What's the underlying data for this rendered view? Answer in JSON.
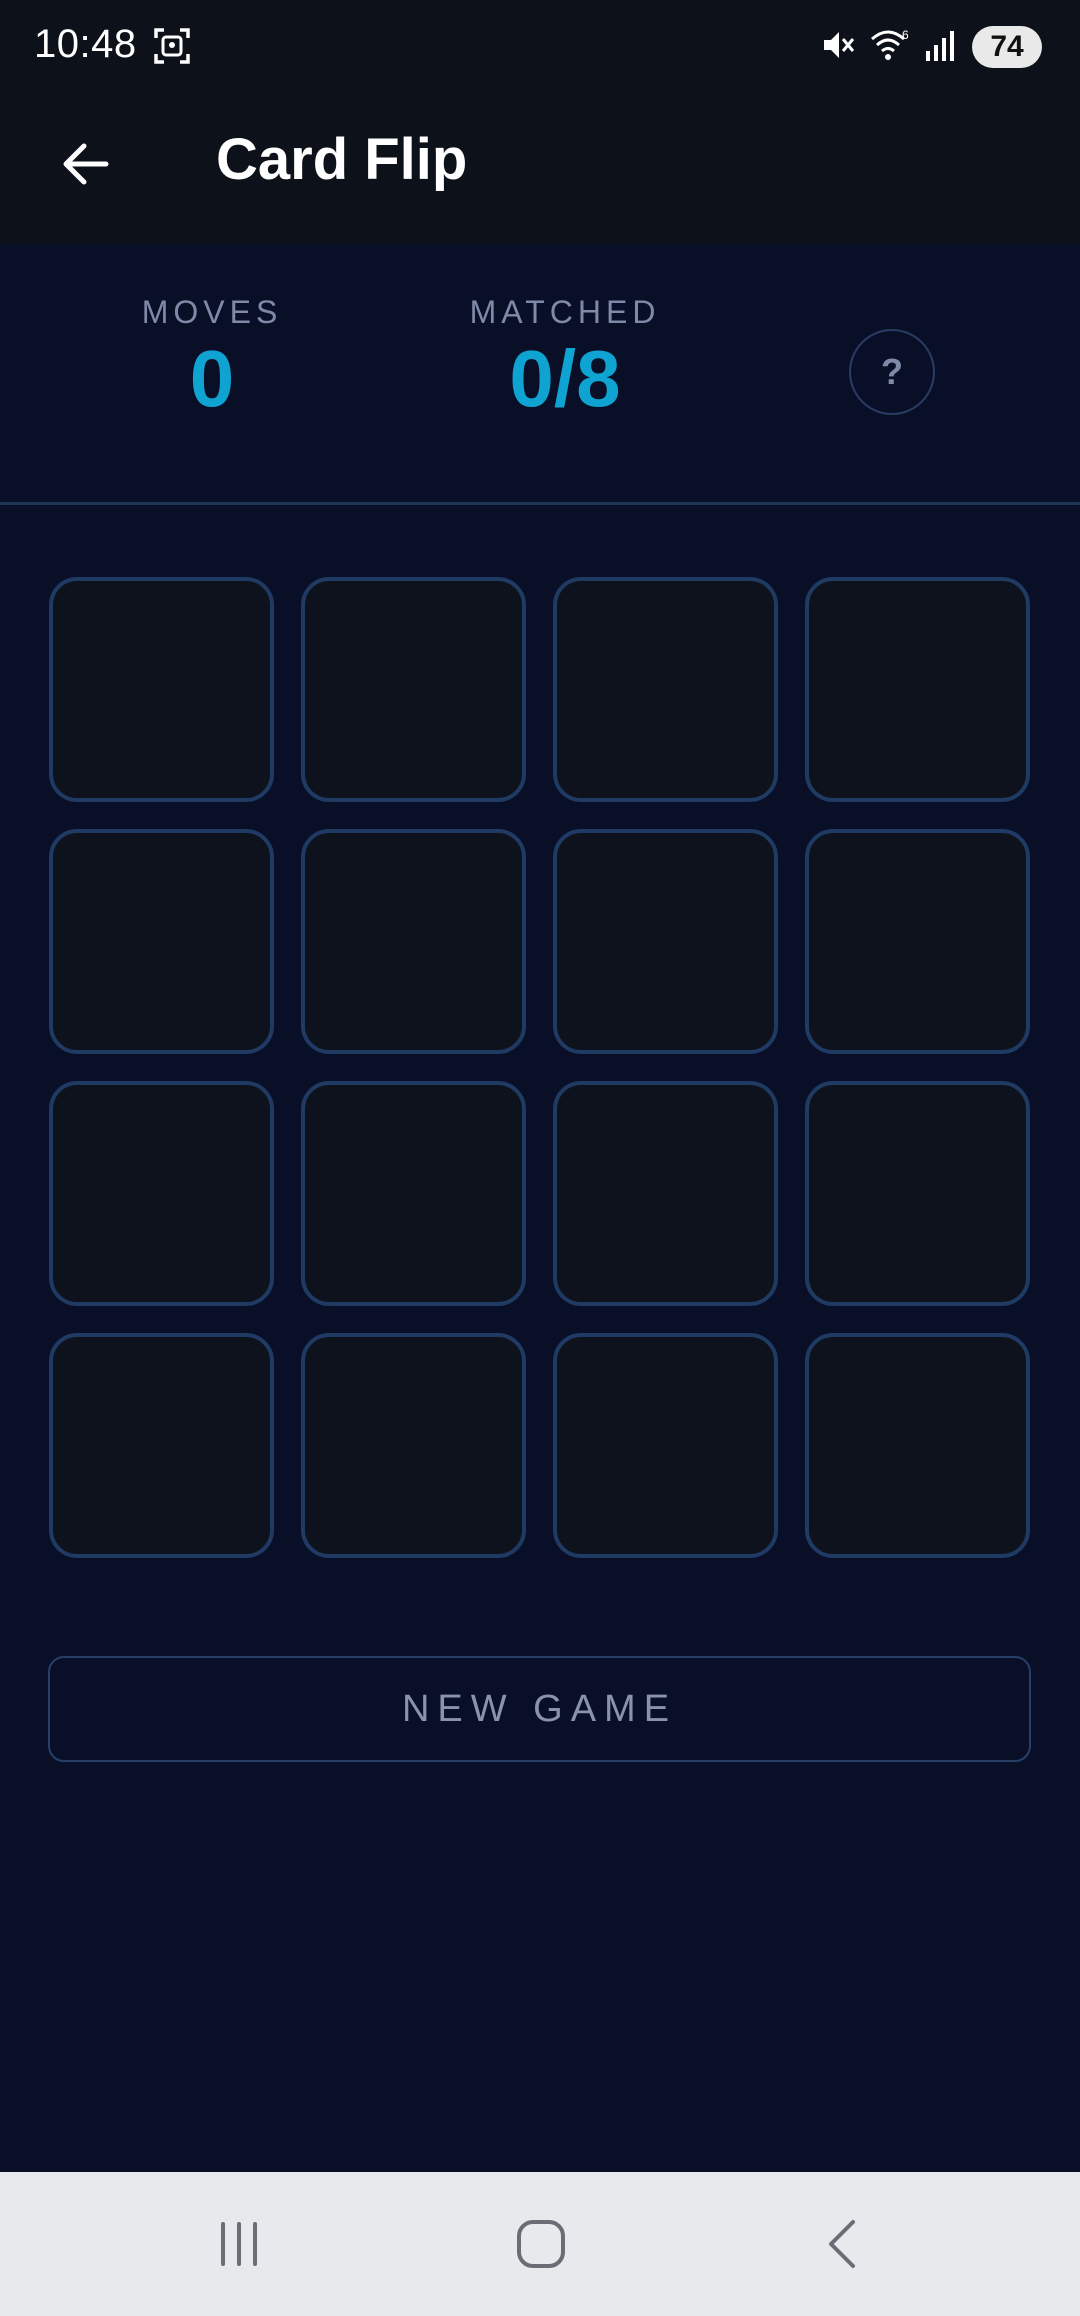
{
  "status_bar": {
    "time": "10:48",
    "battery": "74",
    "icons": [
      "screenshot-icon",
      "mute-icon",
      "wifi-icon",
      "signal-icon"
    ]
  },
  "app_bar": {
    "title": "Card Flip",
    "back_icon": "arrow-left-icon"
  },
  "stats": {
    "moves_label": "MOVES",
    "moves_value": "0",
    "matched_label": "MATCHED",
    "matched_value": "0/8",
    "help_label": "?"
  },
  "board": {
    "rows": 4,
    "columns": 4,
    "cards_face_down": 16
  },
  "actions": {
    "new_game_label": "NEW GAME"
  },
  "colors": {
    "background": "#0a0f28",
    "accent": "#0fa3d1",
    "card_border": "#1f3a63",
    "card_fill": "#0e121c"
  },
  "nav_bar": {
    "icons": [
      "recent-apps-icon",
      "home-icon",
      "back-icon"
    ]
  }
}
